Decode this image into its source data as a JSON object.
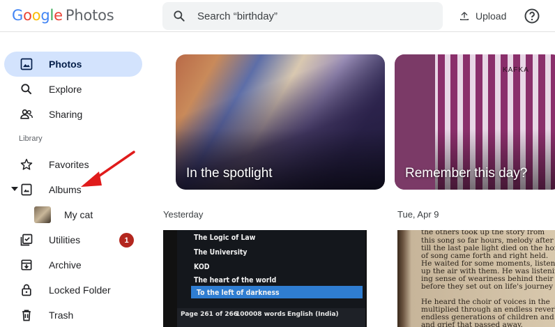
{
  "header": {
    "logo_google": [
      "G",
      "o",
      "o",
      "g",
      "l",
      "e"
    ],
    "product": "Photos",
    "search_placeholder": "Search “birthday”",
    "upload_label": "Upload"
  },
  "sidebar": {
    "items": [
      {
        "label": "Photos",
        "icon": "photo-icon",
        "active": true
      },
      {
        "label": "Explore",
        "icon": "search-icon"
      },
      {
        "label": "Sharing",
        "icon": "people-icon"
      }
    ],
    "library_label": "Library",
    "library_items": [
      {
        "label": "Favorites",
        "icon": "star-icon"
      },
      {
        "label": "Albums",
        "icon": "album-icon",
        "expanded": true
      },
      {
        "label": "My cat",
        "icon": "album-thumbnail"
      },
      {
        "label": "Utilities",
        "icon": "utilities-icon",
        "badge": "1"
      },
      {
        "label": "Archive",
        "icon": "archive-icon"
      },
      {
        "label": "Locked Folder",
        "icon": "lock-icon"
      },
      {
        "label": "Trash",
        "icon": "trash-icon"
      }
    ]
  },
  "main": {
    "cards": [
      {
        "title": "In the spotlight"
      },
      {
        "title": "Remember this day?",
        "cover_text": "KAFKA"
      }
    ],
    "sections": [
      {
        "date": "Yesterday"
      },
      {
        "date": "Tue, Apr 9"
      }
    ],
    "book_menu": [
      "The Logic of Law",
      "The University",
      "KOD",
      "The heart of the world",
      "To the left of darkness"
    ],
    "book_footer": [
      "Page 261 of 266",
      "100008 words",
      "English (India)"
    ],
    "page_text": [
      "the others took up the story from",
      "this song so far hours, melody after melody",
      "till the last pale light died on the horizon.",
      "of song came forth and right held.",
      "He waited for some moments, listening,",
      "up the air with them. He was listening with",
      "ing sense of weariness behind their melody",
      "before they set out on life's journey they were",
      "",
      "He heard the choir of voices in the",
      "multiplied through an endless reverberation",
      "endless generations of children and lo",
      "and grief that passed away."
    ]
  },
  "colors": {
    "active_nav_bg": "#d3e3fd",
    "badge": "#b3261e",
    "annotation_arrow": "#e01b1b"
  }
}
